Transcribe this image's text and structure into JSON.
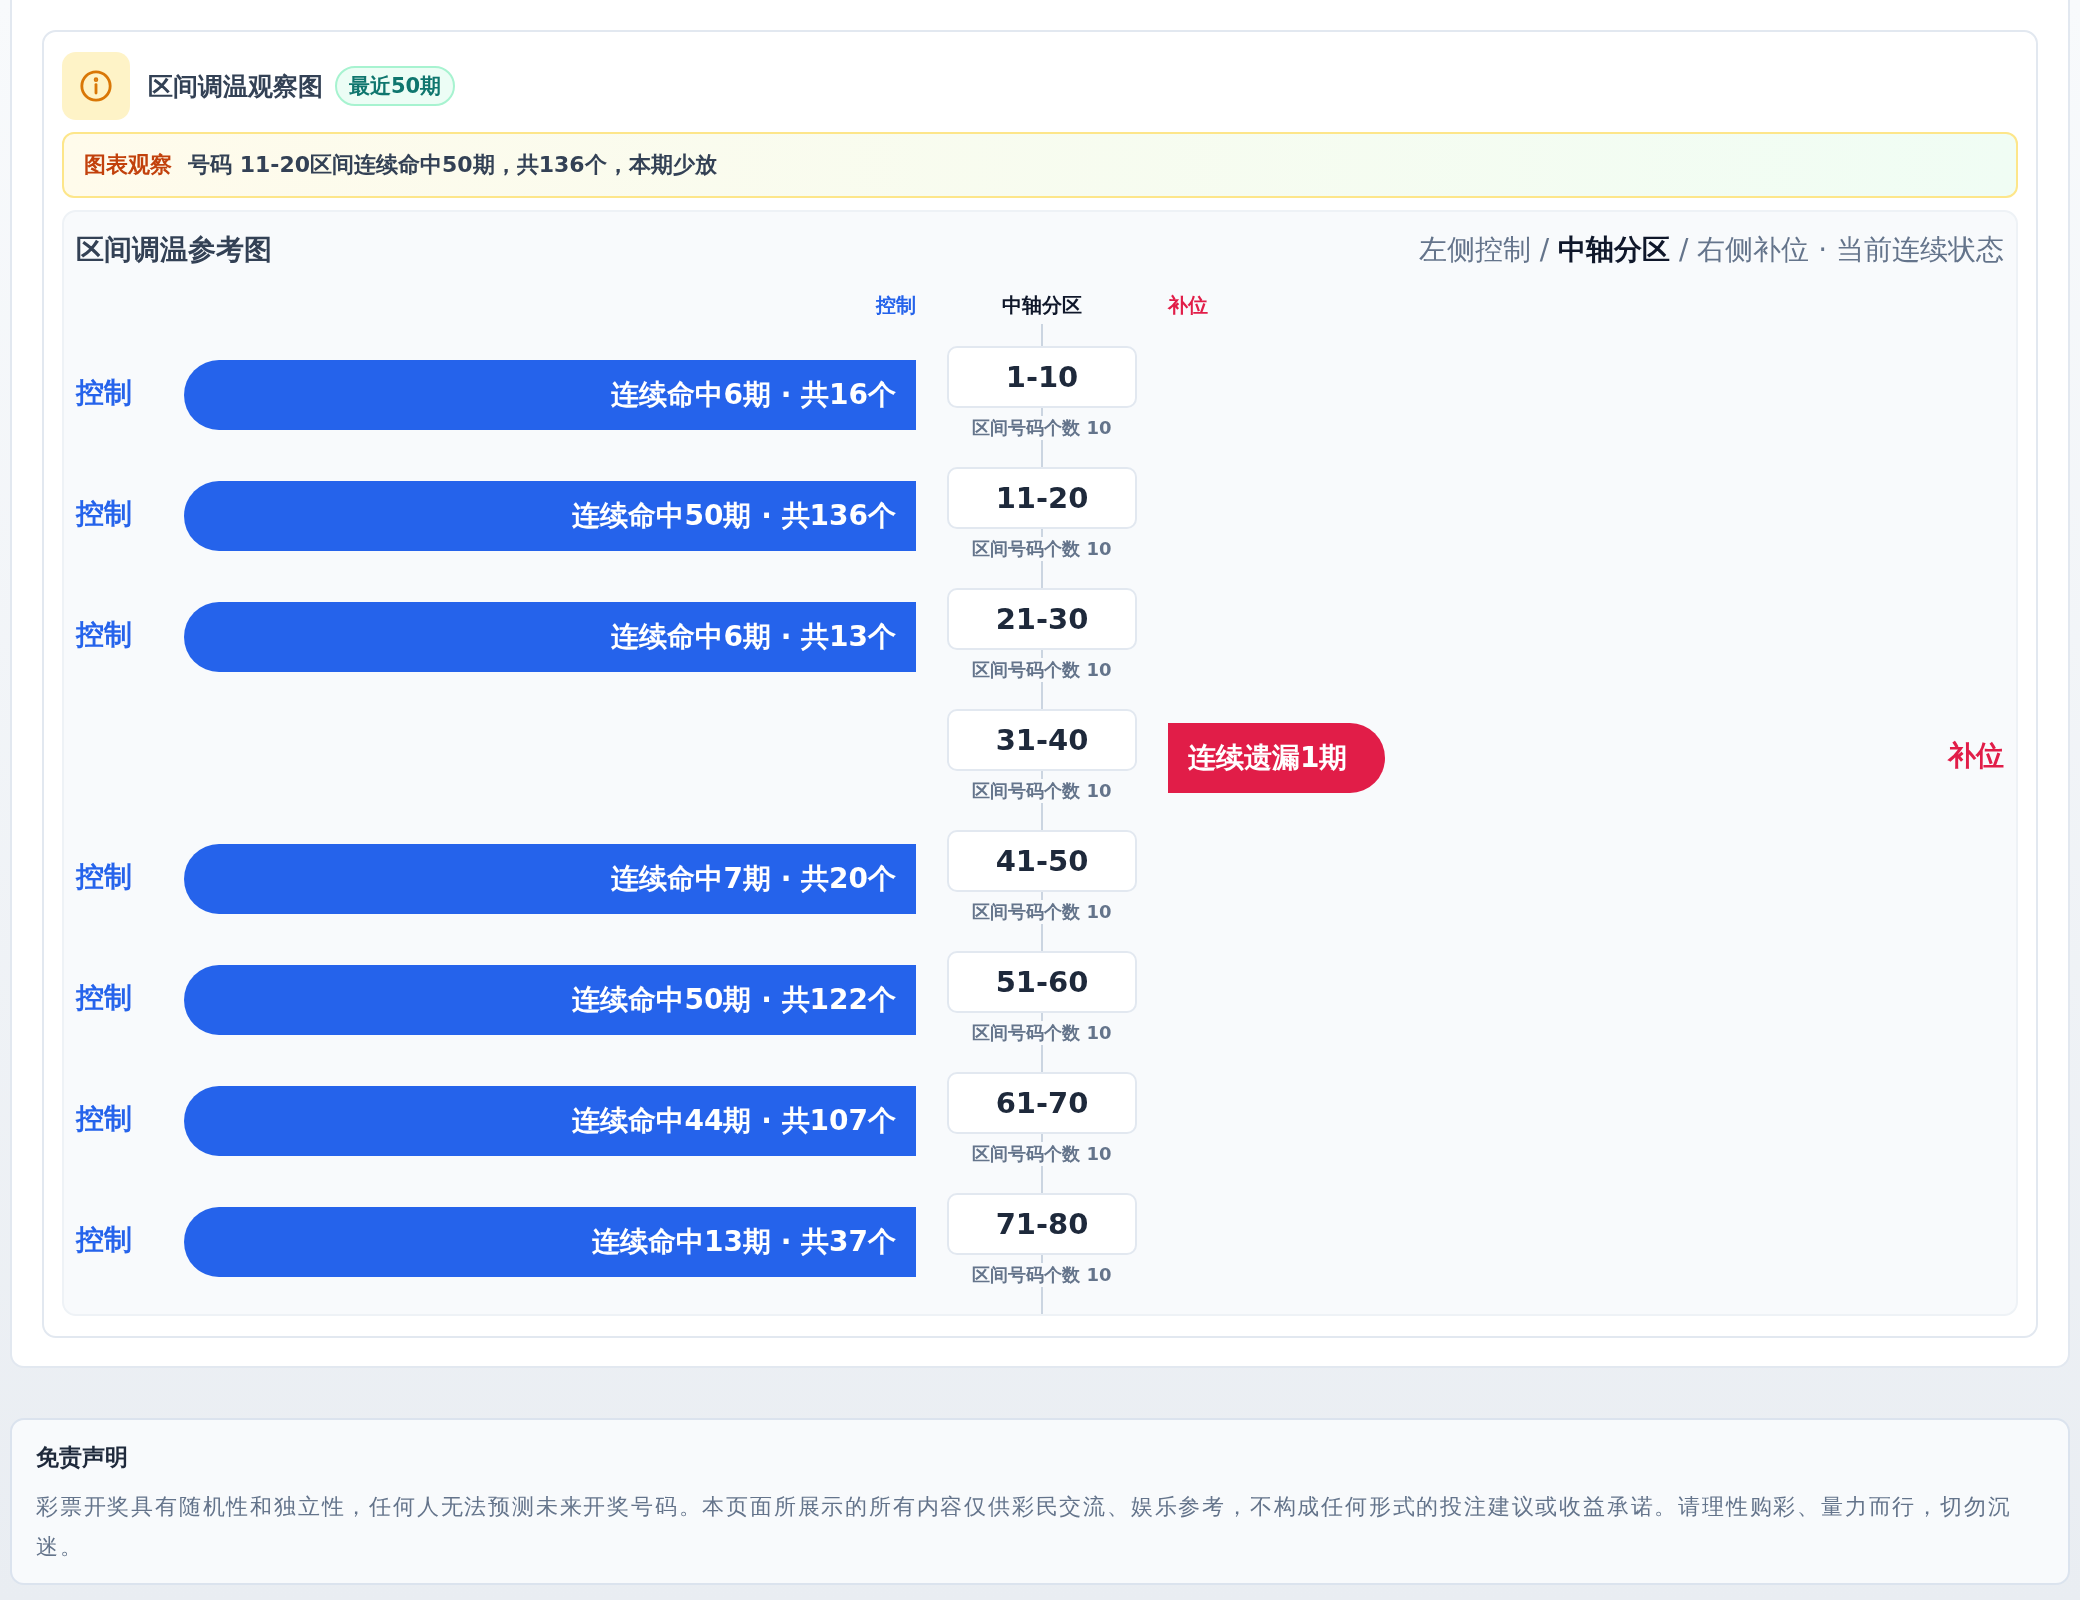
{
  "header": {
    "title": "区间调温观察图",
    "badge": "最近50期"
  },
  "notice": {
    "label": "图表观察",
    "text": "号码 11-20区间连续命中50期，共136个，本期少放"
  },
  "chart": {
    "title": "区间调温参考图",
    "legend": "左侧控制 / **中轴分区** / 右侧补位 · 当前连续状态",
    "column_heads": {
      "left": "控制",
      "center": "中轴分区",
      "right": "补位"
    },
    "rows": [
      {
        "kind": "hit",
        "side_label": "控制",
        "bar": "连续命中6期 · 共16个",
        "range": "1-10",
        "count": "区间号码个数 10"
      },
      {
        "kind": "hit",
        "side_label": "控制",
        "bar": "连续命中50期 · 共136个",
        "range": "11-20",
        "count": "区间号码个数 10"
      },
      {
        "kind": "hit",
        "side_label": "控制",
        "bar": "连续命中6期 · 共13个",
        "range": "21-30",
        "count": "区间号码个数 10"
      },
      {
        "kind": "miss",
        "side_label": "补位",
        "bar": "连续遗漏1期",
        "range": "31-40",
        "count": "区间号码个数 10"
      },
      {
        "kind": "hit",
        "side_label": "控制",
        "bar": "连续命中7期 · 共20个",
        "range": "41-50",
        "count": "区间号码个数 10"
      },
      {
        "kind": "hit",
        "side_label": "控制",
        "bar": "连续命中50期 · 共122个",
        "range": "51-60",
        "count": "区间号码个数 10"
      },
      {
        "kind": "hit",
        "side_label": "控制",
        "bar": "连续命中44期 · 共107个",
        "range": "61-70",
        "count": "区间号码个数 10"
      },
      {
        "kind": "hit",
        "side_label": "控制",
        "bar": "连续命中13期 · 共37个",
        "range": "71-80",
        "count": "区间号码个数 10"
      }
    ]
  },
  "disclaimer": {
    "title": "免责声明",
    "text": "彩票开奖具有随机性和独立性，任何人无法预测未来开奖号码。本页面所展示的所有内容仅供彩民交流、娱乐参考，不构成任何形式的投注建议或收益承诺。请理性购彩、量力而行，切勿沉迷。"
  }
}
